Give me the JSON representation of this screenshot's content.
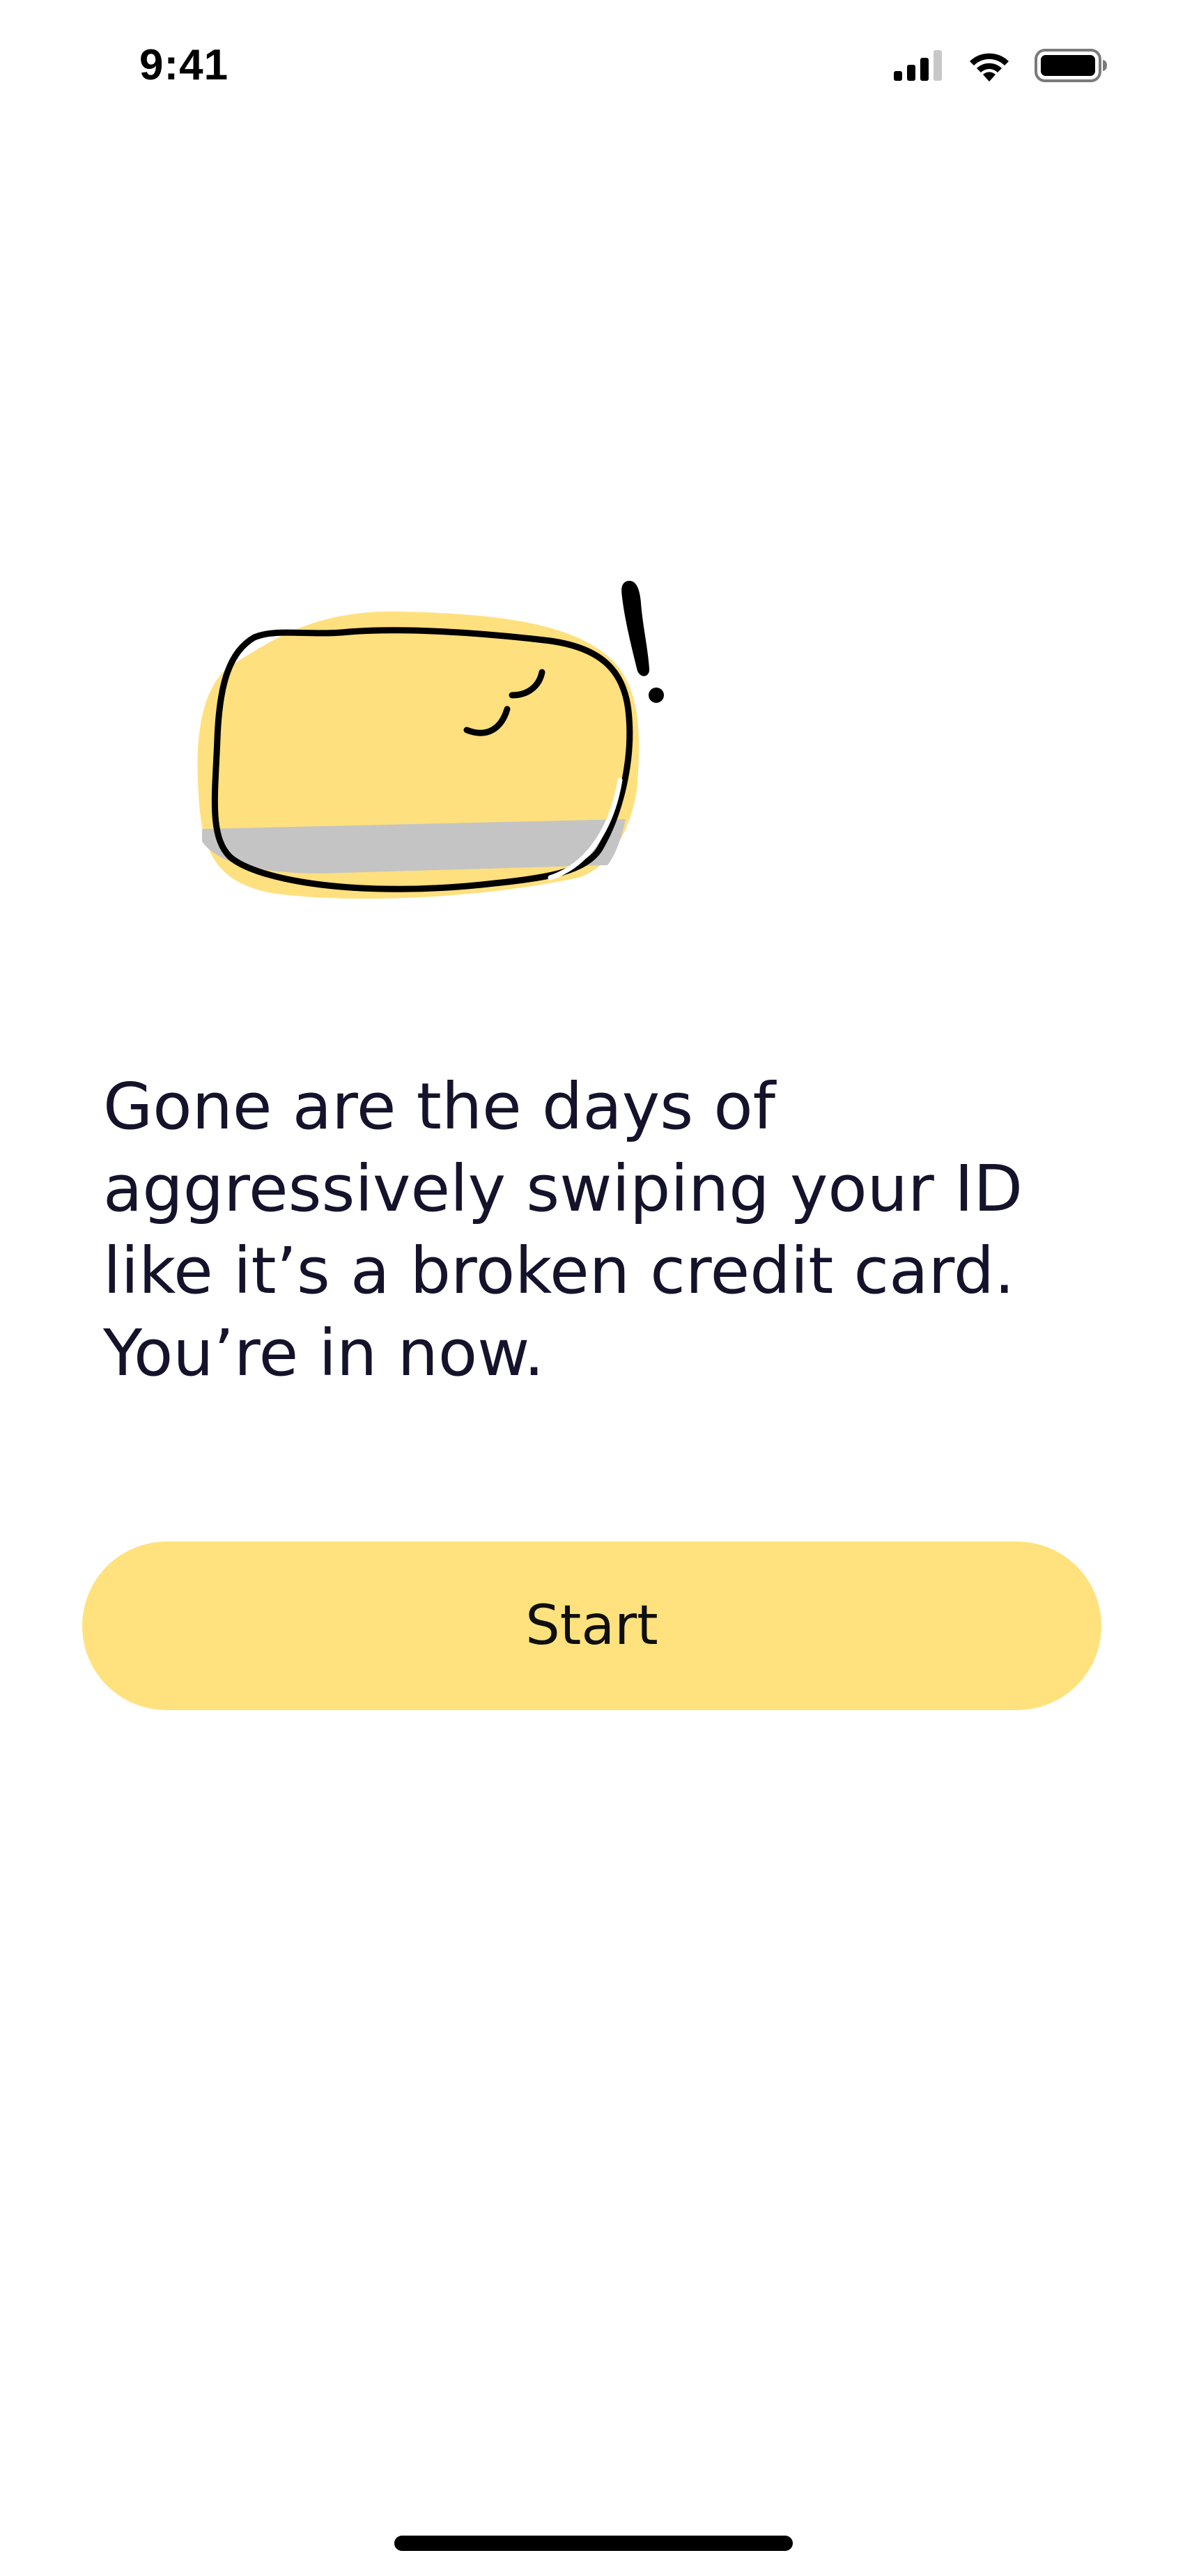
{
  "status_bar": {
    "time": "9:41",
    "signal_icon": "cellular-signal-icon",
    "wifi_icon": "wifi-icon",
    "battery_icon": "battery-icon"
  },
  "illustration": {
    "icon": "sad-credit-card-icon",
    "card_color": "#ffe07e",
    "stripe_color": "#c4c4c4"
  },
  "message": {
    "text": "Gone are the days of\naggressively swiping your ID\nlike it’s a broken credit card.\nYou’re in now."
  },
  "actions": {
    "start_label": "Start"
  },
  "colors": {
    "accent": "#ffe27d",
    "text": "#14132b"
  }
}
